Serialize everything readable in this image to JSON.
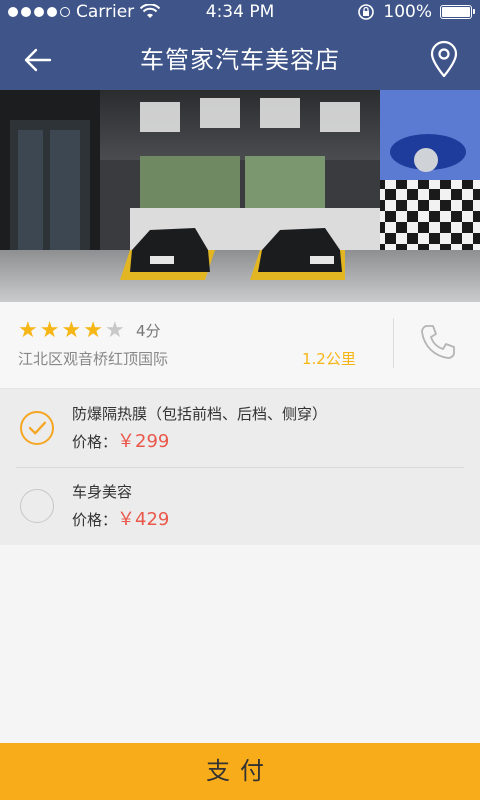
{
  "status_bar": {
    "carrier": "Carrier",
    "time": "4:34 PM",
    "battery": "100%",
    "signal_dots_filled": 4,
    "signal_dots_total": 5
  },
  "nav": {
    "title": "车管家汽车美容店",
    "back_icon": "back-arrow-icon",
    "location_icon": "location-pin-icon"
  },
  "shop": {
    "rating": 4,
    "rating_max": 5,
    "score_text": "4分",
    "address": "江北区观音桥红顶国际",
    "distance": "1.2公里"
  },
  "options": [
    {
      "title": "防爆隔热膜（包括前档、后档、侧穿）",
      "price_label": "价格：",
      "price": "￥299",
      "selected": true
    },
    {
      "title": "车身美容",
      "price_label": "价格：",
      "price": "￥429",
      "selected": false
    }
  ],
  "pay_button": {
    "label": "支付"
  },
  "colors": {
    "header": "#3f5589",
    "accent": "#f6b615",
    "pay": "#f9ac19",
    "price": "#e9584a"
  }
}
